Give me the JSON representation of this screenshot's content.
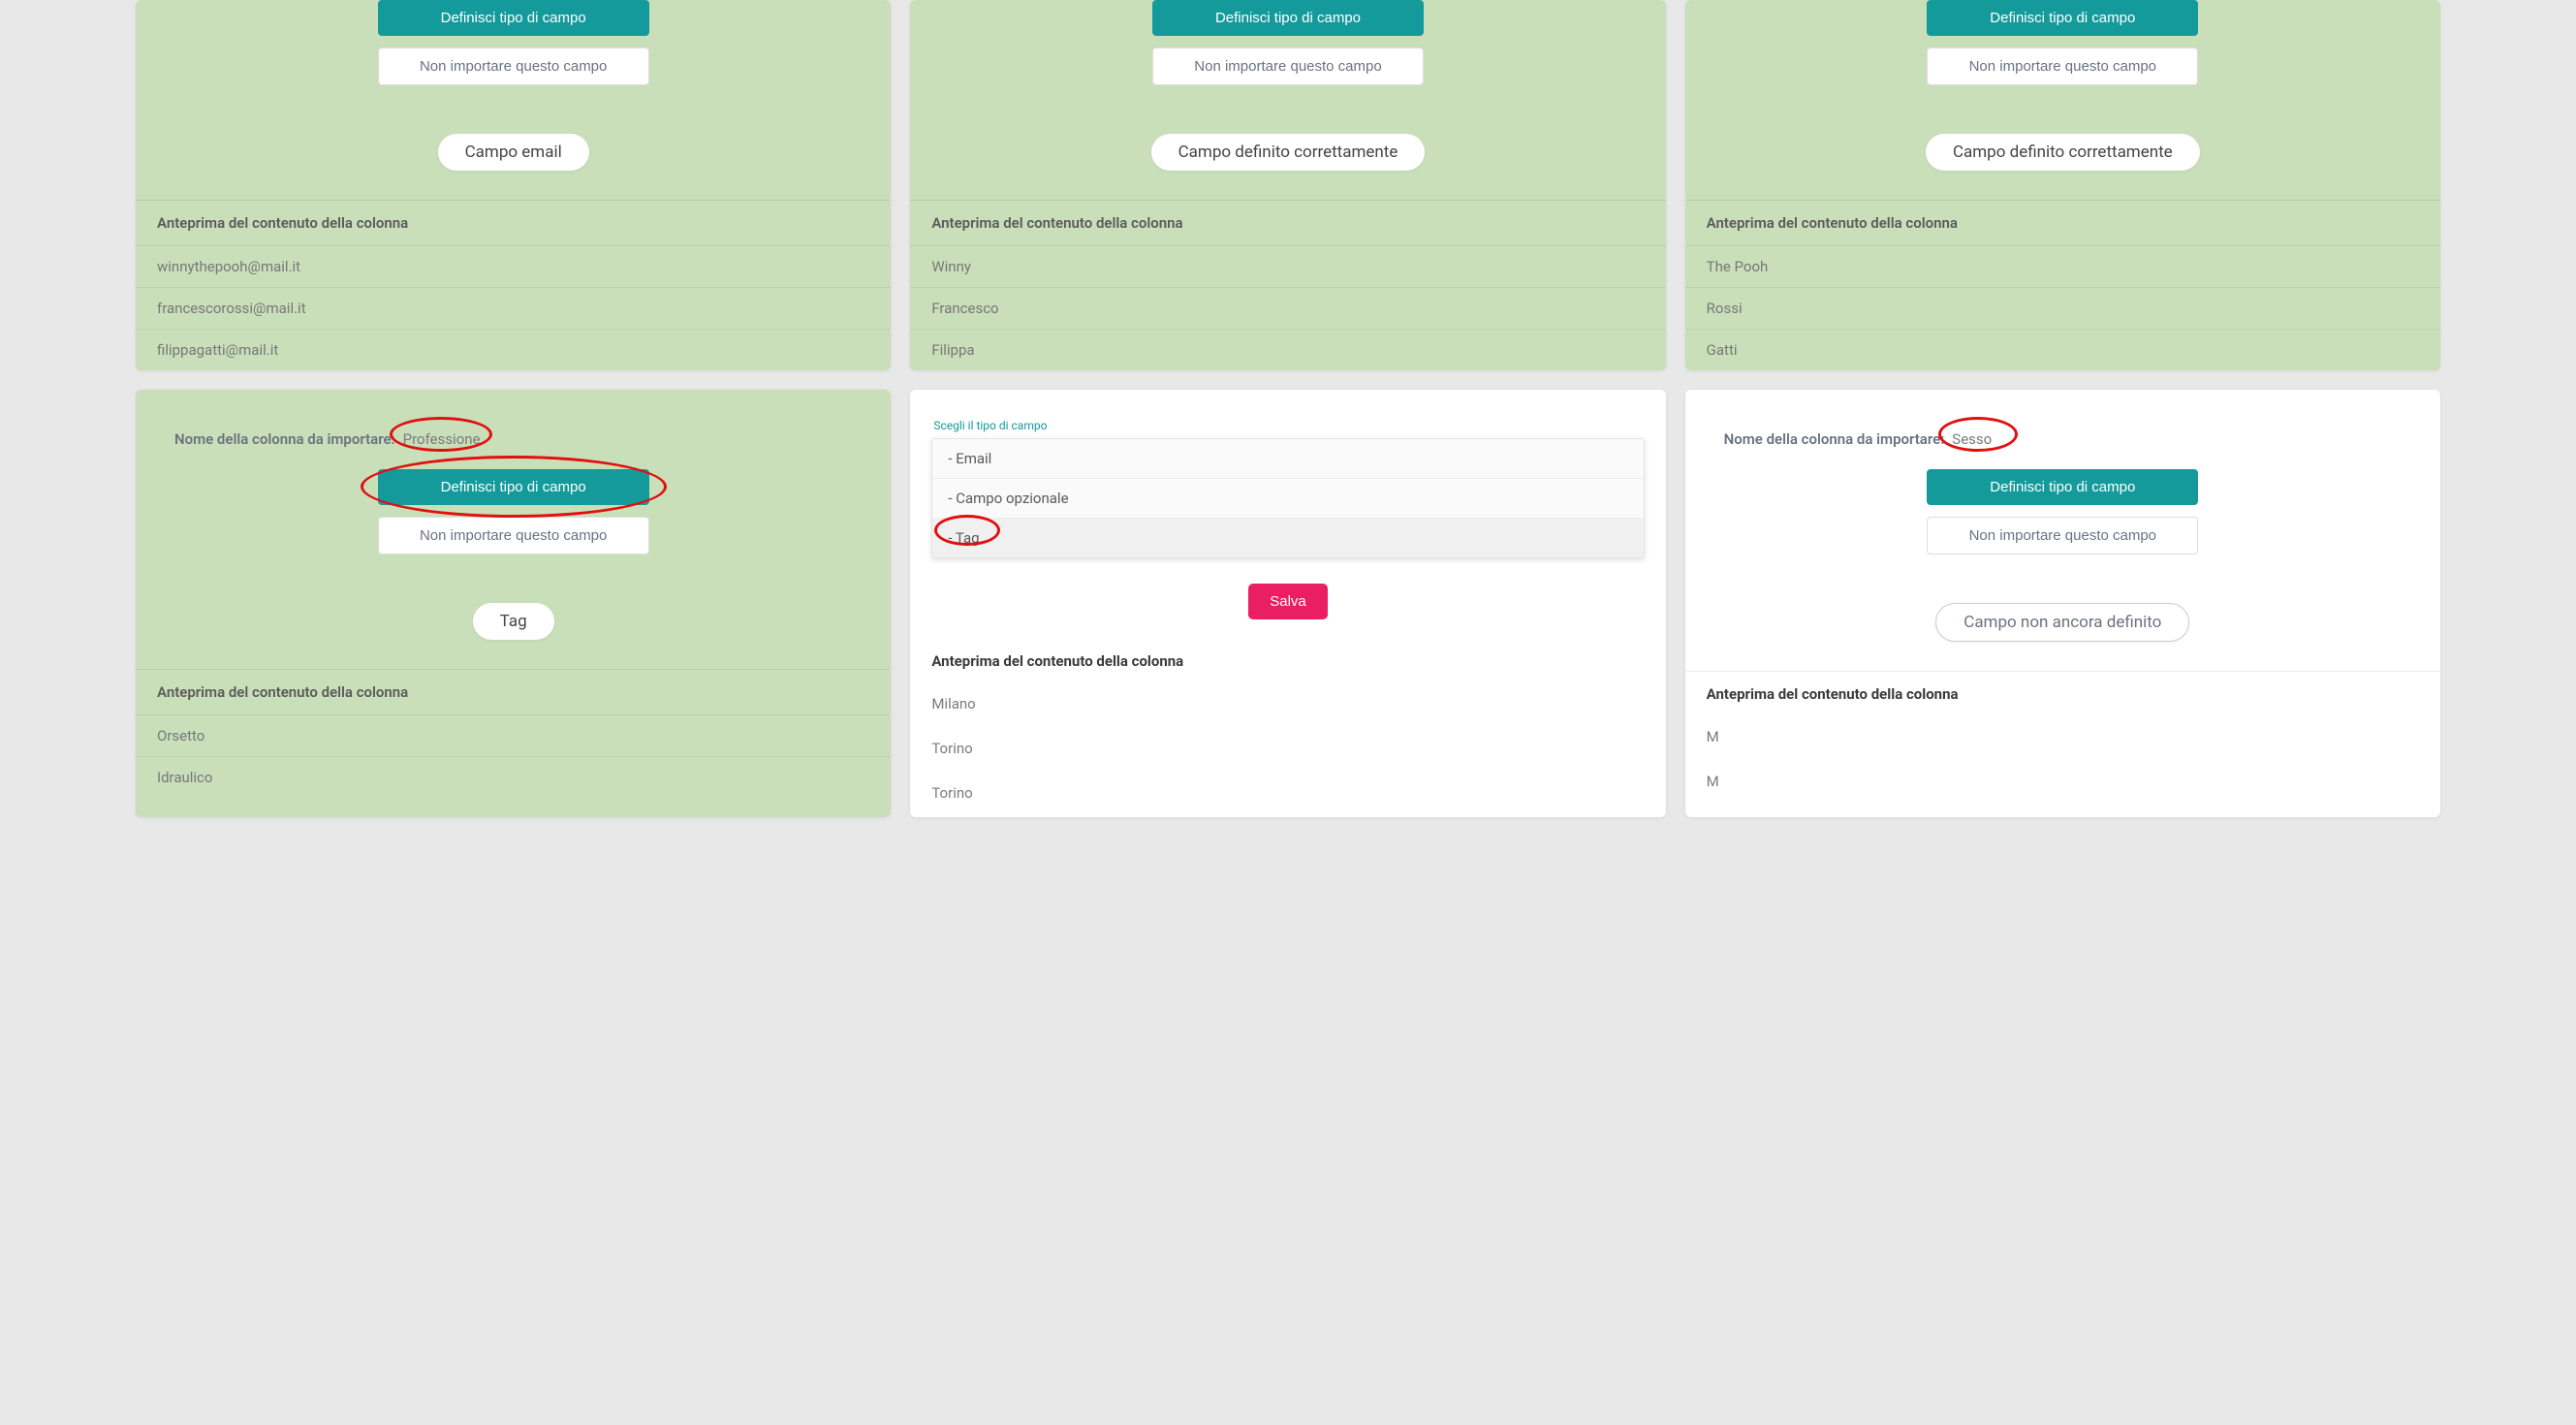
{
  "labels": {
    "define_button": "Definisci tipo di campo",
    "ignore_button": "Non importare questo campo",
    "preview_header": "Anteprima del contenuto della colonna",
    "col_label": "Nome della colonna da importare:",
    "select_label": "Scegli il tipo di campo",
    "save": "Salva"
  },
  "pills": {
    "email": "Campo email",
    "defined": "Campo definito correttamente",
    "tag": "Tag",
    "undefined": "Campo non ancora definito"
  },
  "dropdown": {
    "items": [
      "- Email",
      "- Campo opzionale",
      "- Tag"
    ]
  },
  "cards": {
    "r1c1": {
      "preview": [
        "winnythepooh@mail.it",
        "francescorossi@mail.it",
        "filippagatti@mail.it"
      ]
    },
    "r1c2": {
      "preview": [
        "Winny",
        "Francesco",
        "Filippa"
      ]
    },
    "r1c3": {
      "preview": [
        "The Pooh",
        "Rossi",
        "Gatti"
      ]
    },
    "r2c1": {
      "col_name": "Professione",
      "preview": [
        "Orsetto",
        "Idraulico"
      ]
    },
    "r2c2": {
      "preview": [
        "Milano",
        "Torino",
        "Torino"
      ]
    },
    "r2c3": {
      "col_name": "Sesso",
      "preview": [
        "M",
        "M"
      ]
    }
  }
}
